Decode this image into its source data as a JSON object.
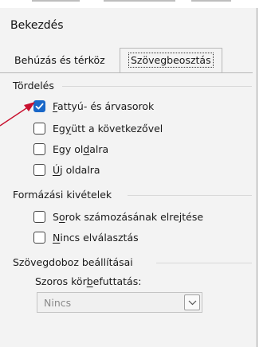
{
  "dialog": {
    "title": "Bekezdés"
  },
  "tabs": [
    {
      "label": "Behúzás és térköz",
      "selected": false,
      "mnemonic": "h"
    },
    {
      "label": "Szövegbeosztás",
      "selected": true
    }
  ],
  "groups": {
    "tordeles": {
      "title": "Tördelés",
      "items": [
        {
          "pre": "",
          "key": "F",
          "post": "attyú- és árvasorok",
          "checked": true
        },
        {
          "pre": "Eg",
          "key": "y",
          "post": "ütt a következővel",
          "checked": false
        },
        {
          "pre": "Egy ol",
          "key": "d",
          "post": "alra",
          "checked": false
        },
        {
          "pre": "",
          "key": "Ú",
          "post": "j oldalra",
          "checked": false
        }
      ]
    },
    "formazasi": {
      "title": "Formázási kivételek",
      "items": [
        {
          "pre": "S",
          "key": "o",
          "post": "rok számozásának elrejtése",
          "checked": false
        },
        {
          "pre": "",
          "key": "N",
          "post": "incs elválasztás",
          "checked": false
        }
      ]
    },
    "szovegdoboz": {
      "title": "Szövegdoboz beállításai",
      "combo_label_pre": "Szoros kör",
      "combo_label_key": "b",
      "combo_label_post": "efuttatás:",
      "combo_value": "Nincs"
    }
  },
  "colors": {
    "checkbox_checked": "#1967c8",
    "annotation_arrow": "#c8102e"
  }
}
